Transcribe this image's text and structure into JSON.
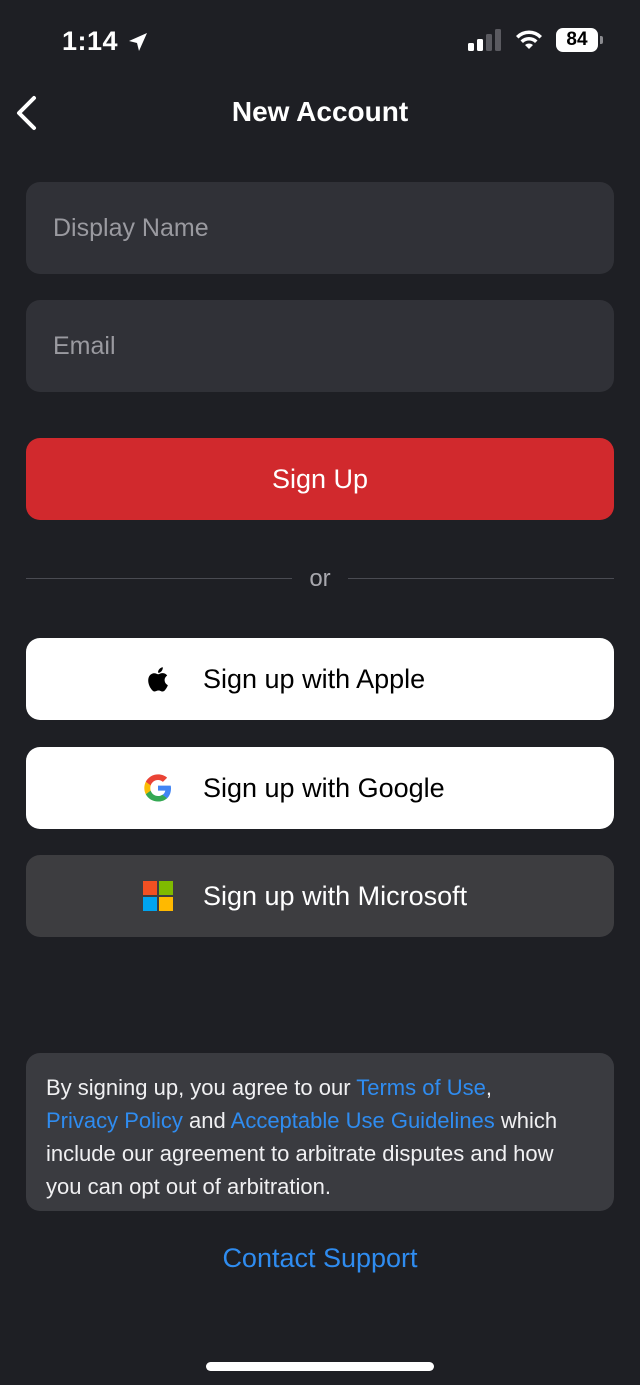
{
  "status_bar": {
    "time": "1:14",
    "battery": "84"
  },
  "nav": {
    "title": "New Account"
  },
  "form": {
    "display_name_placeholder": "Display Name",
    "email_placeholder": "Email",
    "sign_up_label": "Sign Up"
  },
  "divider_text": "or",
  "social": {
    "apple_label": "Sign up with Apple",
    "google_label": "Sign up with Google",
    "microsoft_label": "Sign up with Microsoft"
  },
  "terms": {
    "prefix": "By signing up, you agree to our ",
    "terms_link": "Terms of Use",
    "comma": ",",
    "privacy_link": "Privacy Policy",
    "and": " and ",
    "guidelines_link": "Acceptable Use Guidelines",
    "suffix": " which include our agreement to arbitrate disputes and how you can opt out of arbitration."
  },
  "support_link": "Contact Support",
  "colors": {
    "background": "#1e1f24",
    "primary": "#d1292d",
    "link": "#2f8cf0"
  }
}
